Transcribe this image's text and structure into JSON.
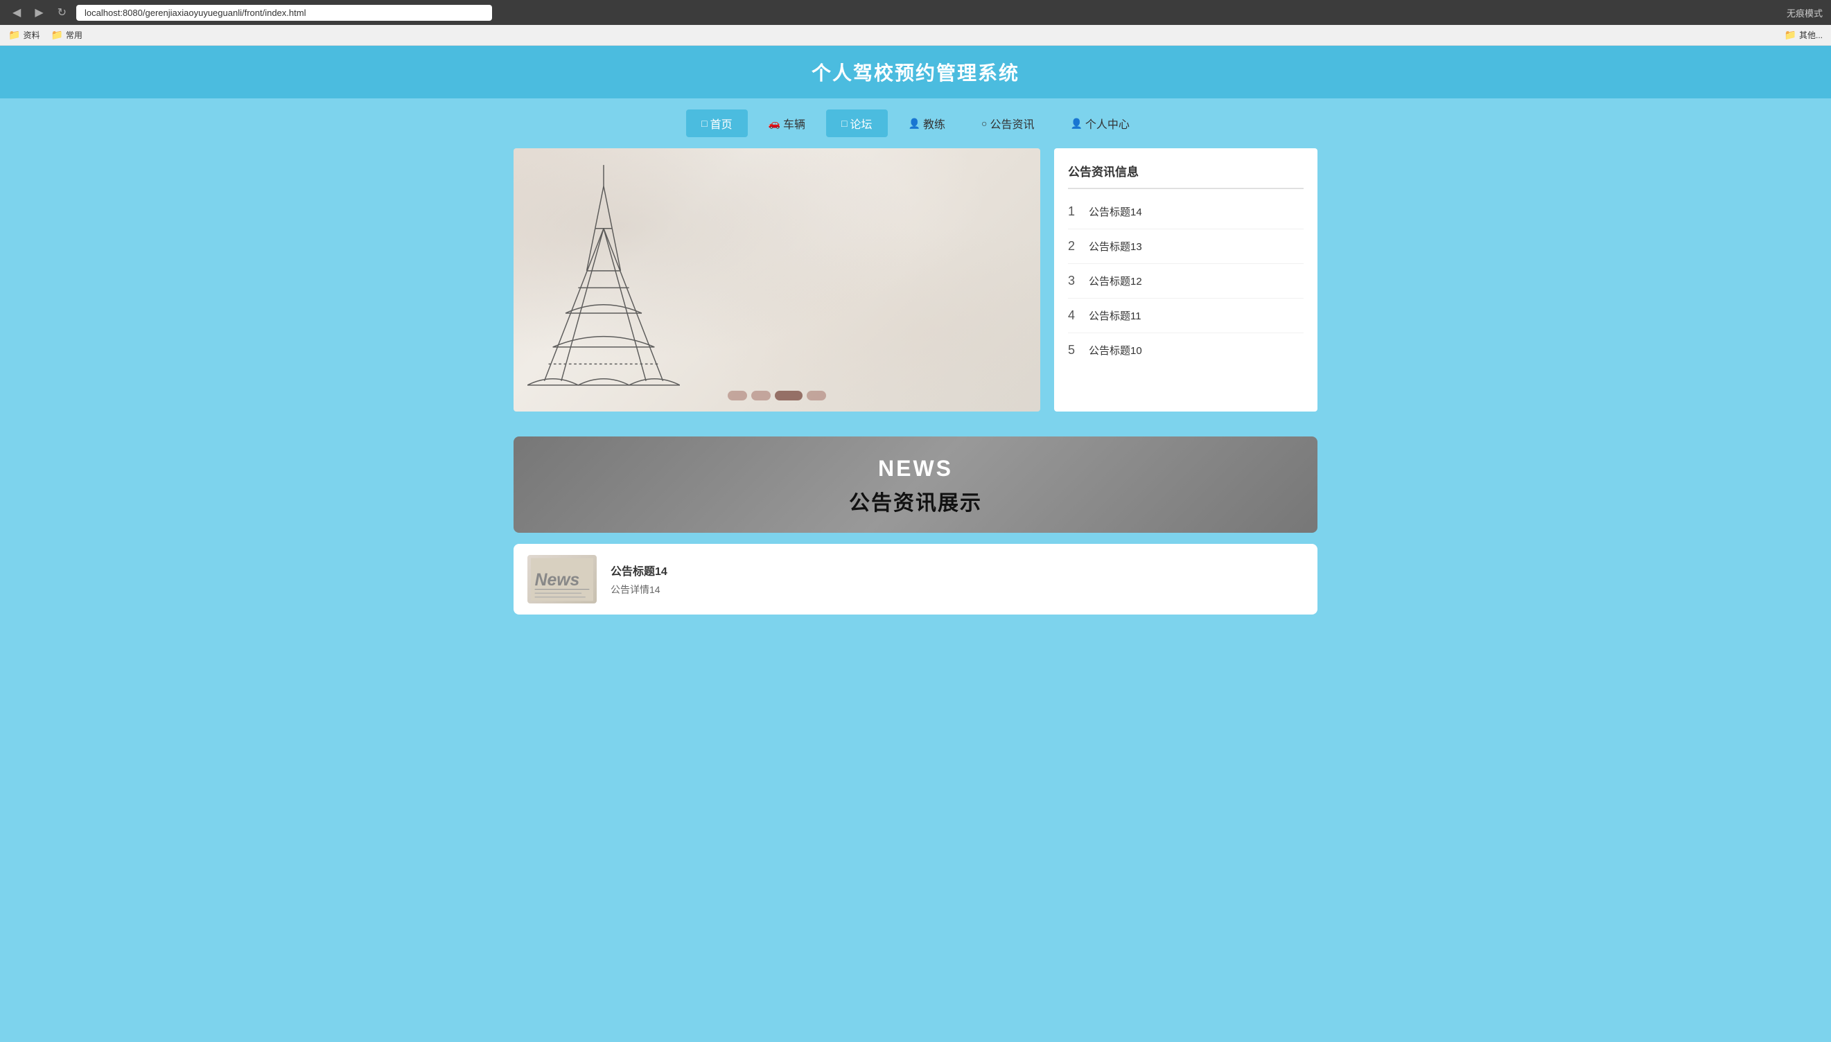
{
  "browser": {
    "url": "localhost:8080/gerenjiaxiaoyuyueguanli/front/index.html",
    "back_btn": "◀",
    "forward_btn": "▶",
    "refresh_btn": "↻",
    "right_text": "无痕模式"
  },
  "bookmarks": {
    "items": [
      {
        "label": "资料",
        "icon": "📁"
      },
      {
        "label": "常用",
        "icon": "📁"
      },
      {
        "label": "其他...",
        "icon": "📁"
      }
    ]
  },
  "header": {
    "title": "个人驾校预约管理系统"
  },
  "nav": {
    "items": [
      {
        "id": "home",
        "icon": "□",
        "label": "首页",
        "active": true
      },
      {
        "id": "vehicle",
        "icon": "🚗",
        "label": "车辆",
        "active": false
      },
      {
        "id": "forum",
        "icon": "□",
        "label": "论坛",
        "active": true
      },
      {
        "id": "instructor",
        "icon": "👤",
        "label": "教练",
        "active": false
      },
      {
        "id": "news",
        "icon": "○",
        "label": "公告资讯",
        "active": false
      },
      {
        "id": "profile",
        "icon": "👤",
        "label": "个人中心",
        "active": false
      }
    ]
  },
  "announcements": {
    "section_title": "公告资讯信息",
    "items": [
      {
        "number": "1",
        "text": "公告标题14"
      },
      {
        "number": "2",
        "text": "公告标题13"
      },
      {
        "number": "3",
        "text": "公告标题12"
      },
      {
        "number": "4",
        "text": "公告标题11"
      },
      {
        "number": "5",
        "text": "公告标题10"
      }
    ]
  },
  "news_banner": {
    "en_label": "NEWS",
    "zh_label": "公告资讯展示"
  },
  "news_items": [
    {
      "image_label": "News",
      "title": "公告标题14",
      "desc": "公告详情14"
    }
  ],
  "carousel": {
    "indicators": [
      {
        "active": false
      },
      {
        "active": false
      },
      {
        "active": true,
        "long": true
      },
      {
        "active": false
      }
    ]
  }
}
